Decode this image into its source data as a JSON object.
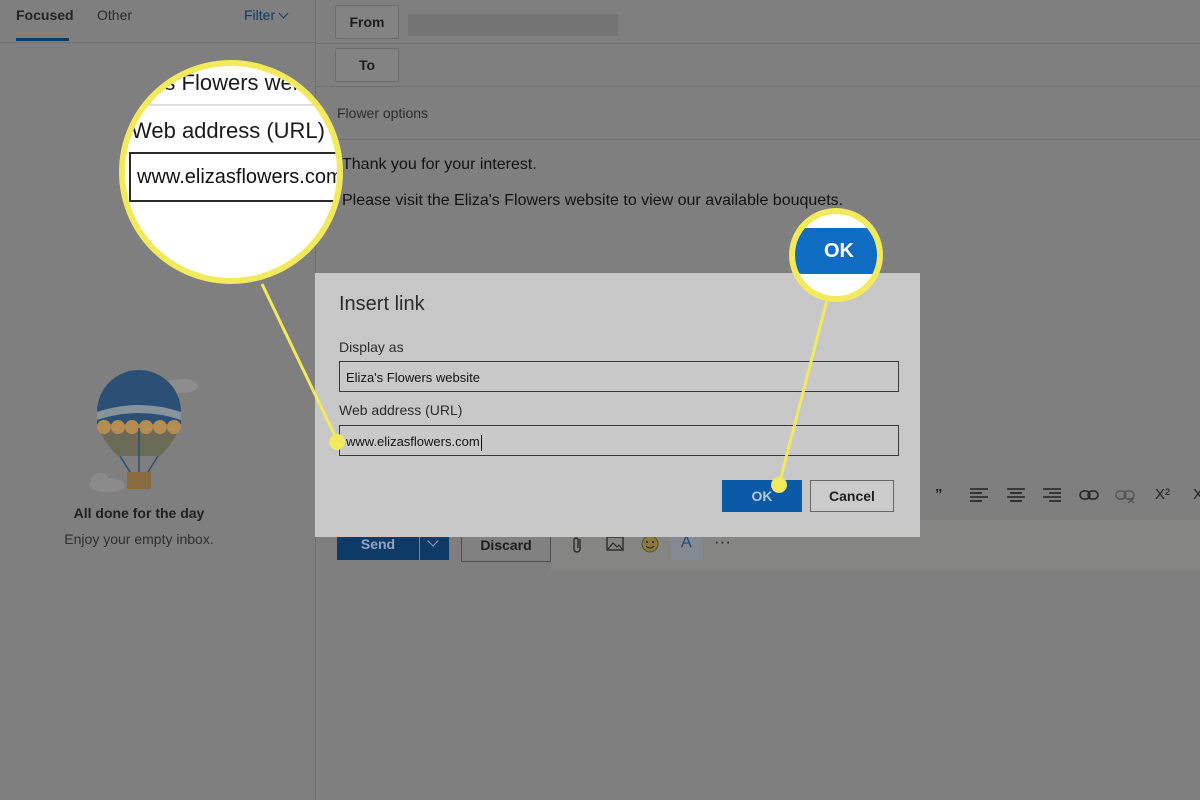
{
  "mail_list": {
    "tabs": [
      {
        "label": "Focused",
        "active": true
      },
      {
        "label": "Other",
        "active": false
      }
    ],
    "filter_label": "Filter",
    "empty_state": {
      "title": "All done for the day",
      "subtitle": "Enjoy your empty inbox.",
      "illustration": "hot-air-balloon"
    }
  },
  "compose": {
    "from_label": "From",
    "to_label": "To",
    "subject": "Flower options",
    "body": [
      "Thank you for your interest.",
      "Please visit the Eliza's Flowers website to view our available bouquets."
    ],
    "send_label": "Send",
    "discard_label": "Discard",
    "format_icons": [
      "quote-icon",
      "align-left-icon",
      "align-center-icon",
      "align-right-icon",
      "link-icon",
      "unlink-icon",
      "superscript-icon",
      "subscript-icon"
    ],
    "toolbar_icons": [
      "attach-icon",
      "image-icon",
      "emoji-icon",
      "format-icon",
      "more-icon"
    ]
  },
  "dialog": {
    "title": "Insert link",
    "display_label": "Display as",
    "display_value": "Eliza's Flowers website",
    "url_label": "Web address (URL)",
    "url_value": "www.elizasflowers.com",
    "ok_label": "OK",
    "cancel_label": "Cancel"
  },
  "callouts": {
    "url_zoom": {
      "partial_text": "za's Flowers web",
      "label": "Web address (URL)",
      "value": "www.elizasflowers.com"
    },
    "ok_zoom": {
      "label": "OK"
    },
    "highlight_color": "#f2ea5c"
  },
  "colors": {
    "accent": "#0f6cc2",
    "overlay": "#7f7f7f"
  }
}
